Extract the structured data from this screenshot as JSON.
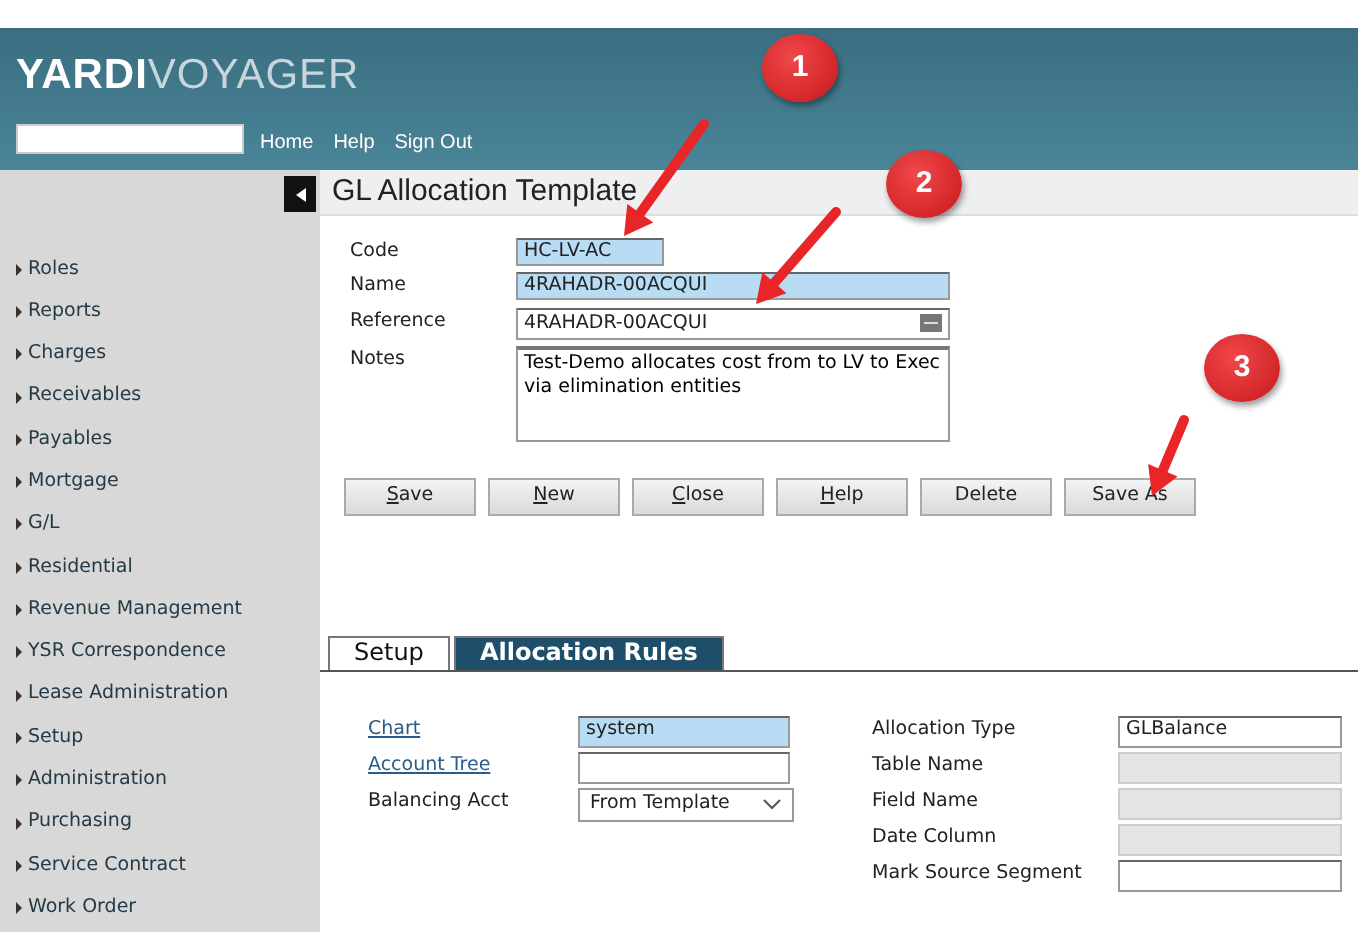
{
  "header": {
    "logo": {
      "brand": "YARDI",
      "product": "VOYAGER"
    },
    "nav_links": [
      "Home",
      "Help",
      "Sign Out"
    ]
  },
  "sidebar": {
    "items": [
      "Roles",
      "Reports",
      "Charges",
      "Receivables",
      "Payables",
      "Mortgage",
      "G/L",
      "Residential",
      "Revenue Management",
      "YSR Correspondence",
      "Lease Administration",
      "Setup",
      "Administration",
      "Purchasing",
      "Service Contract",
      "Work Order"
    ]
  },
  "page": {
    "title": "GL Allocation Template"
  },
  "form": {
    "fields": [
      {
        "label": "Code",
        "value": "HC-LV-AC",
        "kind": "short",
        "highlighted": true
      },
      {
        "label": "Name",
        "value": "4RAHADR-00ACQUI",
        "kind": "text",
        "highlighted": true
      },
      {
        "label": "Reference",
        "value": "4RAHADR-00ACQUI",
        "kind": "lookup",
        "highlighted": false
      },
      {
        "label": "Notes",
        "value": "Test-Demo allocates cost from to LV to Exec via elimination entities",
        "kind": "textarea",
        "highlighted": false
      }
    ]
  },
  "buttons": [
    {
      "label": "Save",
      "mnemonic": true
    },
    {
      "label": "New",
      "mnemonic": true
    },
    {
      "label": "Close",
      "mnemonic": true
    },
    {
      "label": "Help",
      "mnemonic": true
    },
    {
      "label": "Delete",
      "mnemonic": false
    },
    {
      "label": "Save As",
      "mnemonic": false
    }
  ],
  "tabs": [
    {
      "label": "Setup",
      "selected": true
    },
    {
      "label": "Allocation Rules",
      "selected": false
    }
  ],
  "setup_left": [
    {
      "label": "Chart",
      "link": true,
      "kind": "text",
      "value": "system",
      "highlighted": true
    },
    {
      "label": "Account Tree",
      "link": true,
      "kind": "text",
      "highlighted": false
    },
    {
      "label": "Balancing Acct",
      "link": false,
      "kind": "select",
      "value": "From Template",
      "highlighted": false
    }
  ],
  "setup_right": [
    {
      "label": "Allocation Type",
      "value": "GLBalance",
      "disabled": false
    },
    {
      "label": "Table Name",
      "disabled": true
    },
    {
      "label": "Field Name",
      "disabled": true
    },
    {
      "label": "Date Column",
      "disabled": true
    },
    {
      "label": "Mark Source Segment",
      "disabled": false
    }
  ],
  "callouts": [
    {
      "label": "1"
    },
    {
      "label": "2"
    },
    {
      "label": "3"
    }
  ]
}
